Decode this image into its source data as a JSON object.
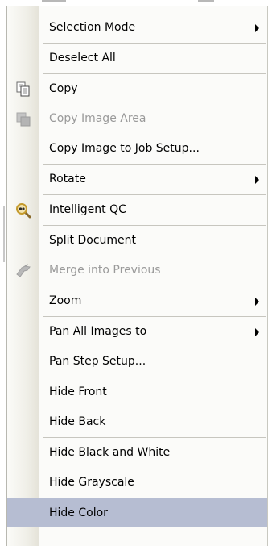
{
  "menu": {
    "items": [
      {
        "label": "Selection Mode",
        "submenu": true
      },
      {
        "label": "Deselect All"
      },
      {
        "label": "Copy",
        "icon": "copy-icon"
      },
      {
        "label": "Copy Image Area",
        "disabled": true,
        "icon": "copy-image-area-icon"
      },
      {
        "label": "Copy Image to Job Setup..."
      },
      {
        "label": "Rotate",
        "submenu": true
      },
      {
        "label": "Intelligent QC",
        "icon": "magnifier-icon"
      },
      {
        "label": "Split Document"
      },
      {
        "label": "Merge into Previous",
        "disabled": true,
        "icon": "merge-icon"
      },
      {
        "label": "Zoom",
        "submenu": true
      },
      {
        "label": "Pan All Images to",
        "submenu": true
      },
      {
        "label": "Pan Step Setup..."
      },
      {
        "label": "Hide Front"
      },
      {
        "label": "Hide Back"
      },
      {
        "label": "Hide Black and White"
      },
      {
        "label": "Hide Grayscale"
      },
      {
        "label": "Hide Color",
        "highlighted": true
      }
    ]
  },
  "colors": {
    "highlight": "#b6bdd2",
    "disabled_text": "#9a9a9a",
    "menu_background": "#fbfbf9"
  }
}
